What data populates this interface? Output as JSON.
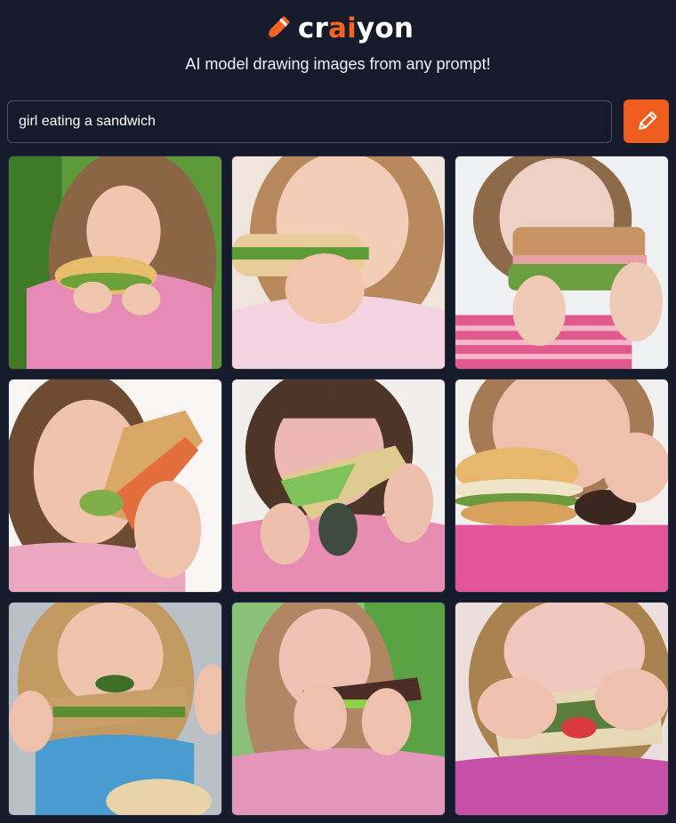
{
  "header": {
    "logo_parts": [
      "cr",
      "ai",
      "yon"
    ],
    "tagline": "AI model drawing images from any prompt!"
  },
  "prompt": {
    "value": "girl eating a sandwich",
    "button_icon": "pencil-icon"
  },
  "colors": {
    "background": "#151b2b",
    "accent": "#ef5d1e",
    "input_border": "#4a5165"
  },
  "results": [
    {
      "name": "result-image-1"
    },
    {
      "name": "result-image-2"
    },
    {
      "name": "result-image-3"
    },
    {
      "name": "result-image-4"
    },
    {
      "name": "result-image-5"
    },
    {
      "name": "result-image-6"
    },
    {
      "name": "result-image-7"
    },
    {
      "name": "result-image-8"
    },
    {
      "name": "result-image-9"
    }
  ]
}
